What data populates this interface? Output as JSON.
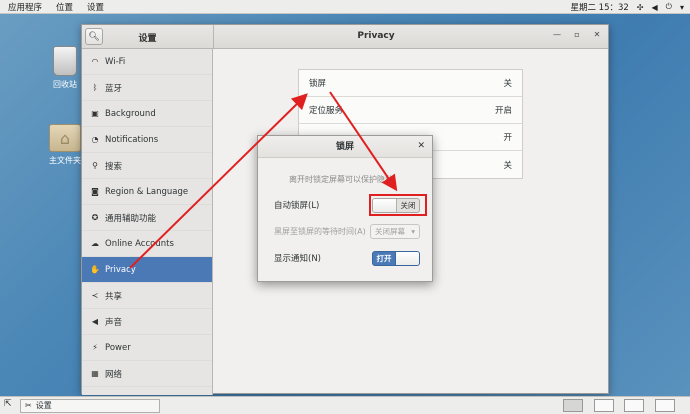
{
  "topbar": {
    "applications": "应用程序",
    "places": "位置",
    "settings": "设置",
    "datetime": "星期二 15：32"
  },
  "desktop": {
    "trash_label": "回收站",
    "home_label": "主文件夹"
  },
  "window": {
    "sidebar_title": "设置",
    "panel_title": "Privacy",
    "sidebar_items": [
      {
        "label": "Wi-Fi",
        "icon": "wifi-icon"
      },
      {
        "label": "蓝牙",
        "icon": "bluetooth-icon"
      },
      {
        "label": "Background",
        "icon": "background-icon"
      },
      {
        "label": "Notifications",
        "icon": "bell-icon"
      },
      {
        "label": "搜索",
        "icon": "search-icon"
      },
      {
        "label": "Region & Language",
        "icon": "camera-icon"
      },
      {
        "label": "通用辅助功能",
        "icon": "accessibility-icon"
      },
      {
        "label": "Online Accounts",
        "icon": "cloud-icon"
      },
      {
        "label": "Privacy",
        "icon": "hand-icon"
      },
      {
        "label": "共享",
        "icon": "share-icon"
      },
      {
        "label": "声音",
        "icon": "speaker-icon"
      },
      {
        "label": "Power",
        "icon": "power-icon"
      },
      {
        "label": "网络",
        "icon": "network-icon"
      }
    ],
    "active_index": 8,
    "privacy_rows": [
      {
        "label": "锁屏",
        "value": "关"
      },
      {
        "label": "定位服务",
        "value": "开启"
      },
      {
        "label": "",
        "value": "开"
      },
      {
        "label": "",
        "value": "关"
      }
    ]
  },
  "dialog": {
    "title": "锁屏",
    "description": "离开时锁定屏幕可以保护隐私。",
    "auto_lock_label": "自动锁屏(L)",
    "auto_lock_state": "关闭",
    "delay_label": "黑屏至锁屏的等待时间(A)",
    "delay_value": "关闭屏幕",
    "show_notifications_label": "显示通知(N)",
    "show_notifications_state": "打开"
  },
  "taskbar": {
    "task_label": "设置"
  },
  "colors": {
    "accent": "#4a79b6",
    "annotation": "#e02020"
  }
}
